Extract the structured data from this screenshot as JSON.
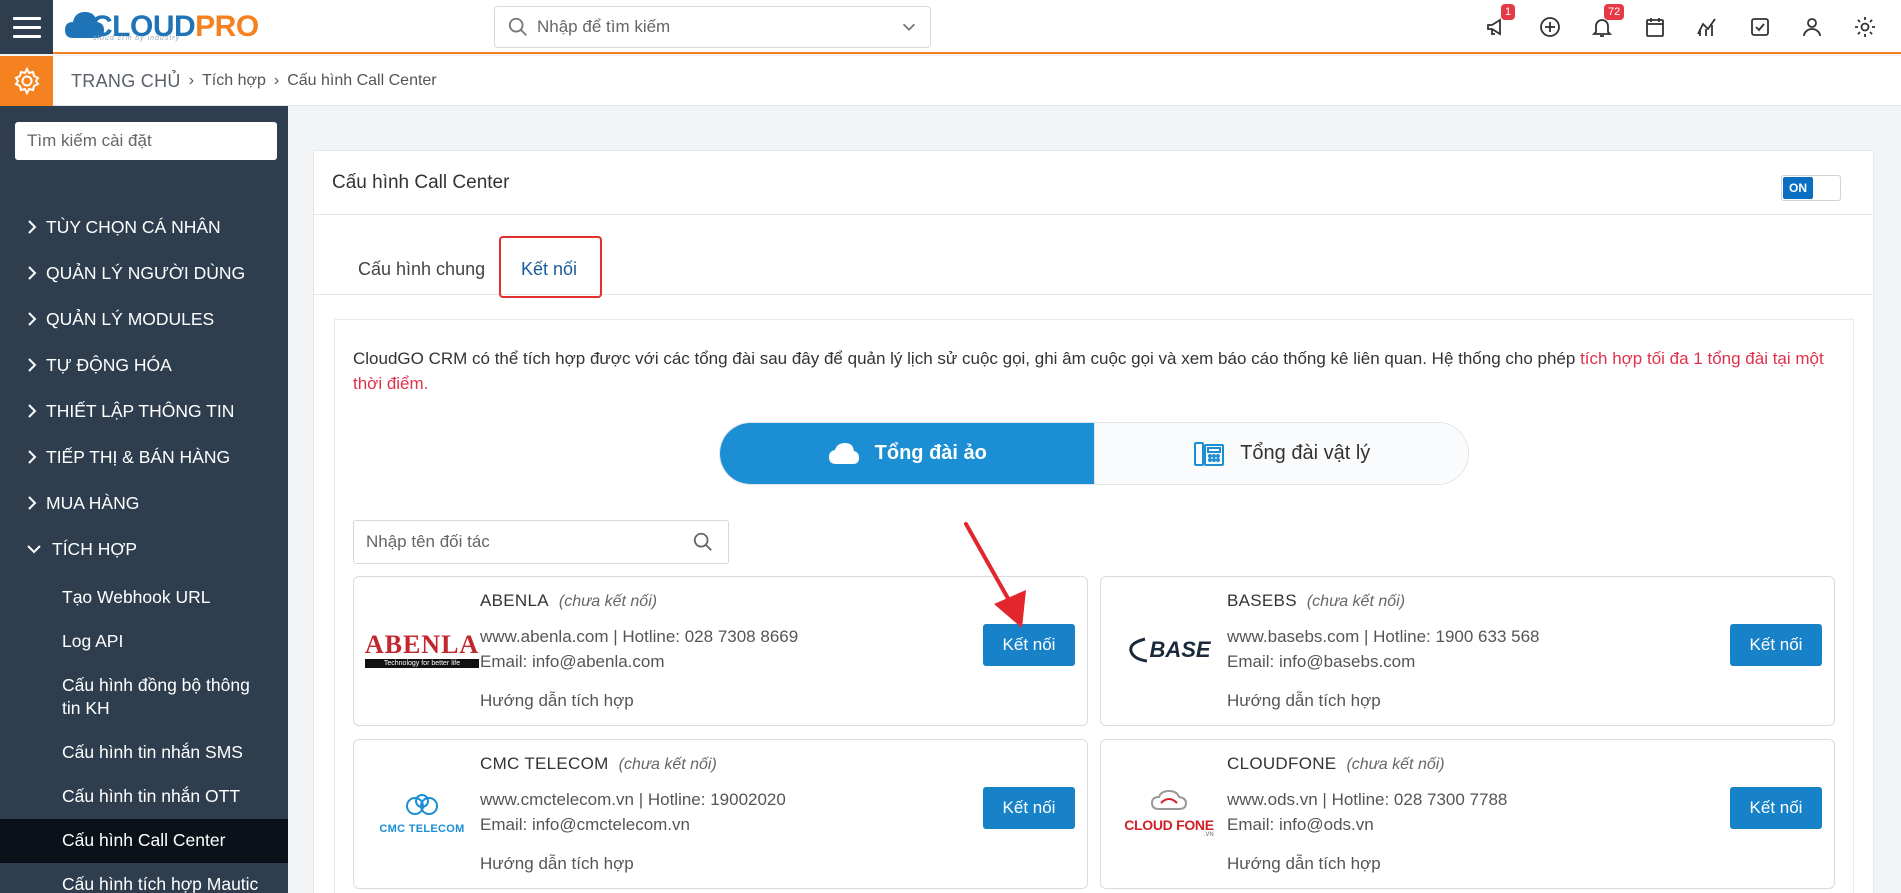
{
  "topbar": {
    "logo_main": "CLOUD",
    "logo_accent": "PRO",
    "logo_tagline": "cloud crm by industry",
    "search_placeholder": "Nhập để tìm kiếm",
    "icons": [
      {
        "name": "megaphone-icon",
        "badge": "1"
      },
      {
        "name": "plus-circle-icon",
        "badge": null
      },
      {
        "name": "bell-icon",
        "badge": "72"
      },
      {
        "name": "calendar-icon",
        "badge": null
      },
      {
        "name": "chart-icon",
        "badge": null
      },
      {
        "name": "task-check-icon",
        "badge": null
      },
      {
        "name": "user-icon",
        "badge": null
      },
      {
        "name": "settings-gear-icon",
        "badge": null
      }
    ],
    "accent_color": "#f58220"
  },
  "breadcrumb": {
    "home": "TRANG CHỦ",
    "level1": "Tích hợp",
    "level2": "Cấu hình Call Center"
  },
  "sidebar": {
    "search_placeholder": "Tìm kiếm cài đặt",
    "items": [
      {
        "label": "TÙY CHỌN CÁ NHÂN"
      },
      {
        "label": "QUẢN LÝ NGƯỜI DÙNG"
      },
      {
        "label": "QUẢN LÝ MODULES"
      },
      {
        "label": "TỰ ĐỘNG HÓA"
      },
      {
        "label": "THIẾT LẬP THÔNG TIN"
      },
      {
        "label": "TIẾP THỊ & BÁN HÀNG"
      },
      {
        "label": "MUA HÀNG"
      },
      {
        "label": "TÍCH HỢP"
      }
    ],
    "subitems": [
      {
        "label": "Tạo Webhook URL"
      },
      {
        "label": "Log API"
      },
      {
        "label": "Cấu hình đồng bộ thông tin KH"
      },
      {
        "label": "Cấu hình tin nhắn SMS"
      },
      {
        "label": "Cấu hình tin nhắn OTT"
      },
      {
        "label": "Cấu hình Call Center"
      },
      {
        "label": "Cấu hình tích hợp Mautic"
      }
    ],
    "bg_color": "#2f3e4e"
  },
  "main": {
    "title": "Cấu hình Call Center",
    "toggle_label": "ON",
    "tabs": [
      {
        "label": "Cấu hình chung"
      },
      {
        "label": "Kết nối"
      }
    ],
    "intro_text": "CloudGO CRM có thể tích hợp được với các tổng đài sau đây để quản lý lịch sử cuộc gọi, ghi âm cuộc gọi và xem báo cáo thống kê liên quan. Hệ thống cho phép ",
    "intro_highlight": "tích hợp tối đa 1 tổng đài tại một thời điểm.",
    "segments": [
      {
        "label": "Tổng đài ảo",
        "icon": "cloud-icon"
      },
      {
        "label": "Tổng đài vật lý",
        "icon": "pbx-phone-icon"
      }
    ],
    "partner_search_placeholder": "Nhập tên đối tác",
    "partners": [
      {
        "name": "ABENLA",
        "status": "(chưa kết nối)",
        "line1": "www.abenla.com | Hotline: 028 7308 8669",
        "line2": "Email: info@abenla.com",
        "guide": "Hướng dẫn tích hợp",
        "button": "Kết nối",
        "logo_text": "ABENLA",
        "logo_sub": "Technology for better life"
      },
      {
        "name": "BASEBS",
        "status": "(chưa kết nối)",
        "line1": "www.basebs.com | Hotline: 1900 633 568",
        "line2": "Email: info@basebs.com",
        "guide": "Hướng dẫn tích hợp",
        "button": "Kết nối",
        "logo_text": "BASE",
        "logo_sub": ""
      },
      {
        "name": "CMC TELECOM",
        "status": "(chưa kết nối)",
        "line1": "www.cmctelecom.vn | Hotline: 19002020",
        "line2": "Email: info@cmctelecom.vn",
        "guide": "Hướng dẫn tích hợp",
        "button": "Kết nối",
        "logo_text": "CMC TELECOM",
        "logo_sub": ""
      },
      {
        "name": "CLOUDFONE",
        "status": "(chưa kết nối)",
        "line1": "www.ods.vn | Hotline: 028 7300 7788",
        "line2": "Email: info@ods.vn",
        "guide": "Hướng dẫn tích hợp",
        "button": "Kết nối",
        "logo_text": "CLOUD FONE",
        "logo_sub": ".VN"
      }
    ],
    "primary_color": "#1782c8",
    "highlight_color": "#e23030"
  }
}
